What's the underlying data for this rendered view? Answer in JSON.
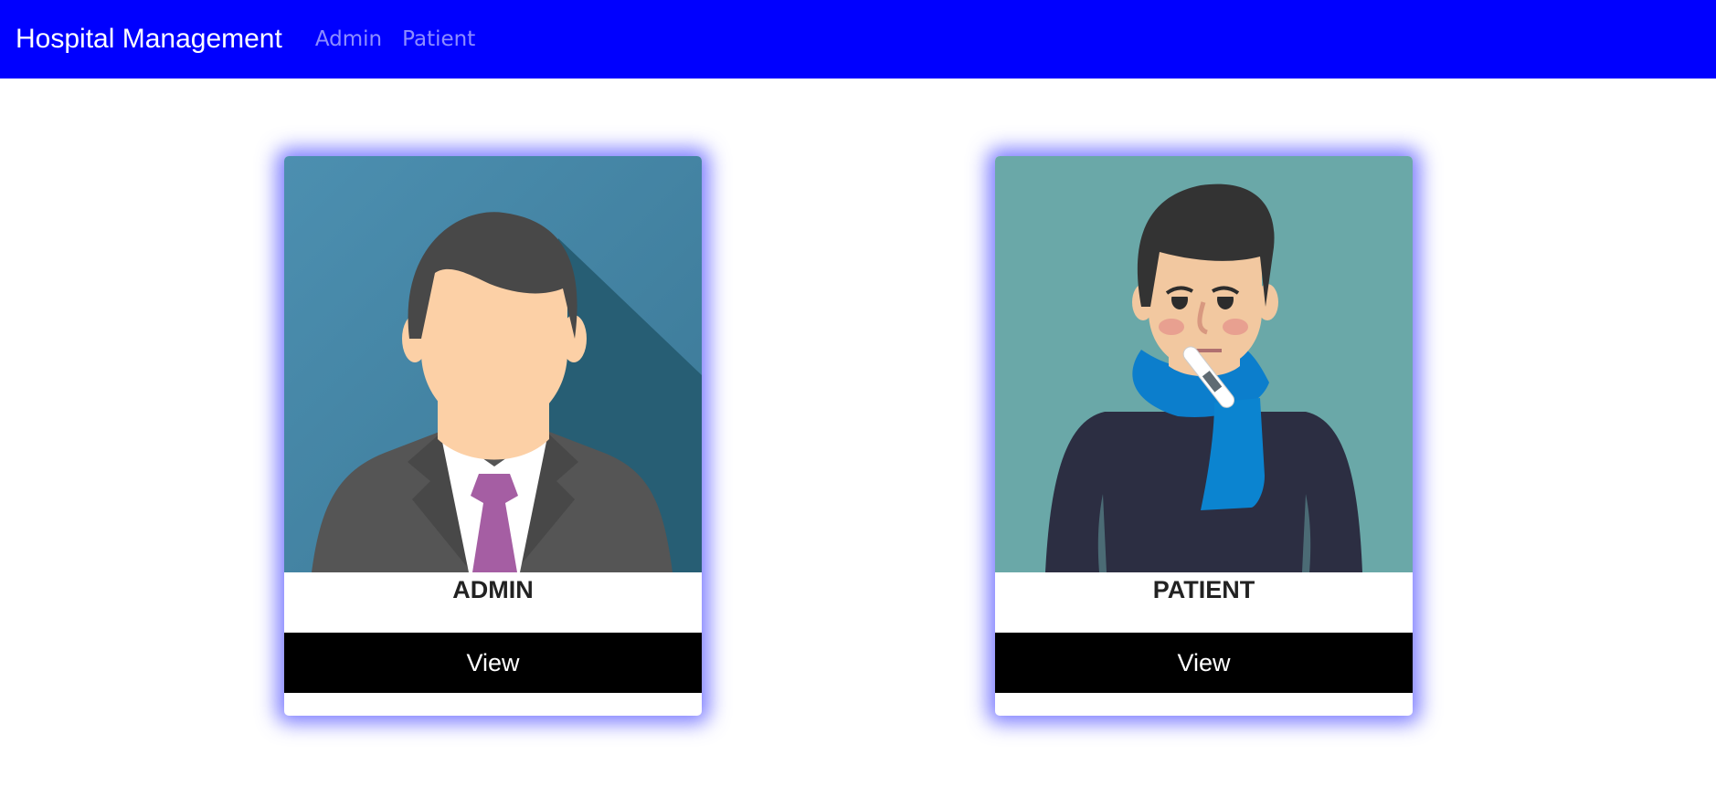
{
  "navbar": {
    "brand": "Hospital Management",
    "links": [
      {
        "label": "Admin"
      },
      {
        "label": "Patient"
      }
    ],
    "background": "#0000ff"
  },
  "cards": [
    {
      "title": "ADMIN",
      "button_label": "View",
      "icon": "admin-avatar-illustration"
    },
    {
      "title": "PATIENT",
      "button_label": "View",
      "icon": "sick-patient-illustration"
    }
  ],
  "colors": {
    "card_glow": "#5050ff",
    "button_bg": "#000000",
    "admin_bg": "#4a8aab",
    "patient_bg": "#6aa8a8"
  }
}
